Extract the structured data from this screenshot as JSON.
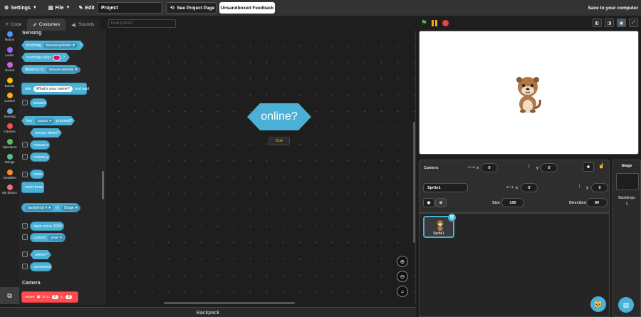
{
  "menubar": {
    "settings": "Settings",
    "file": "File",
    "edit": "Edit",
    "project_title": "Project",
    "see_project_page": "See Project Page",
    "unsandboxed_feedback": "Unsandboxed Feedback",
    "save_to_computer": "Save to your computer"
  },
  "tabs": [
    {
      "label": "Code",
      "icon": "code-icon"
    },
    {
      "label": "Costumes",
      "icon": "brush-icon"
    },
    {
      "label": "Sounds",
      "icon": "speaker-icon"
    }
  ],
  "active_tab": "Costumes",
  "find": {
    "placeholder": "Find (Ctrl+F)"
  },
  "categories": [
    {
      "label": "Motion",
      "color": "#4c97ff"
    },
    {
      "label": "Looks",
      "color": "#9966ff"
    },
    {
      "label": "Sound",
      "color": "#cf63cf"
    },
    {
      "label": "Events",
      "color": "#ffbf00"
    },
    {
      "label": "Control",
      "color": "#ffab19"
    },
    {
      "label": "Sensing",
      "color": "#5cb1d6"
    },
    {
      "label": "Camera",
      "color": "#ff4c4c"
    },
    {
      "label": "Operators",
      "color": "#59c059"
    },
    {
      "label": "Strings",
      "color": "#59c08a"
    },
    {
      "label": "Variables",
      "color": "#ff8c1a"
    },
    {
      "label": "My Blocks",
      "color": "#ff6680"
    }
  ],
  "palette": {
    "section_sensing": "Sensing",
    "touching": "touching",
    "mouse_pointer": "mouse-pointer",
    "q": "?",
    "touching_color": "touching color",
    "distance_to": "distance to",
    "ask": "ask",
    "ask_default": "What's your name?",
    "and_wait": "and wait",
    "answer": "answer",
    "key": "key",
    "space": "space",
    "pressed": "pressed?",
    "mouse_down": "mouse down?",
    "mouse_x": "mouse x",
    "mouse_y": "mouse y",
    "timer": "timer",
    "reset_timer": "reset timer",
    "backdrop_num": "backdrop #",
    "of": "of",
    "stage": "Stage",
    "days_since": "days since 2000",
    "current": "current",
    "year": "year",
    "online": "online?",
    "username": "username",
    "section_camera": "Camera",
    "move": "move",
    "to_x": "to x:",
    "x_val": "0",
    "y_lbl": "y:",
    "y_val": "0"
  },
  "workspace": {
    "block_label": "online?",
    "report_value": "true"
  },
  "backpack": "Backpack",
  "sprite_info": {
    "camera_label": "Camera",
    "x_label": "x",
    "x_value": "0",
    "y_label": "y",
    "y_value": "0",
    "sprite_name": "Sprite1",
    "sprite_x_label": "x",
    "sprite_x": "0",
    "sprite_y_label": "y",
    "sprite_y": "0",
    "size_label": "Size",
    "size": "100",
    "direction_label": "Direction",
    "direction": "90"
  },
  "sprites": [
    {
      "name": "Sprite1"
    }
  ],
  "stage_pane": {
    "title": "Stage",
    "backdrops_label": "Backdrops",
    "backdrops_count": "1"
  }
}
